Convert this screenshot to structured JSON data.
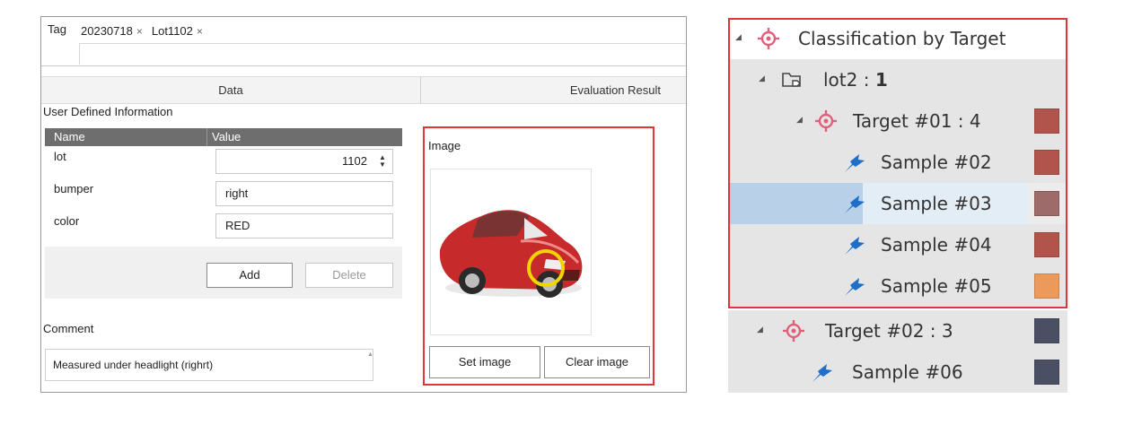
{
  "tag_panel": {
    "label": "Tag",
    "tags": [
      {
        "text": "20230718",
        "remove": "×"
      },
      {
        "text": "Lot1102",
        "remove": "×"
      }
    ]
  },
  "columns": {
    "data": "Data",
    "evaluation": "Evaluation Result"
  },
  "user_info": {
    "title": "User Defined Information",
    "headers": {
      "name": "Name",
      "value": "Value"
    },
    "rows": [
      {
        "name": "lot",
        "value": "1102"
      },
      {
        "name": "bumper",
        "value": "right"
      },
      {
        "name": "color",
        "value": "RED"
      }
    ],
    "add_label": "Add",
    "delete_label": "Delete"
  },
  "comment": {
    "label": "Comment",
    "text": "Measured under headlight (righrt)"
  },
  "image_section": {
    "label": "Image",
    "set_label": "Set image",
    "clear_label": "Clear image"
  },
  "tree": {
    "root": {
      "label": "Classification by Target",
      "icon": "target-icon"
    },
    "folder": {
      "label": "lot2 : ",
      "count": "1",
      "icon": "folder-tag-icon"
    },
    "target1": {
      "label": "Target #01 : 4",
      "color": "#b0544c"
    },
    "samples1": [
      {
        "label": "Sample #02",
        "color": "#b0544c"
      },
      {
        "label": "Sample #03",
        "color": "#9e6a6a"
      },
      {
        "label": "Sample #04",
        "color": "#b0544c"
      },
      {
        "label": "Sample #05",
        "color": "#ec9a5c"
      }
    ],
    "target2": {
      "label": "Target #02 : 3",
      "color": "#4b4f63"
    },
    "samples2": [
      {
        "label": "Sample #06",
        "color": "#4b4f63"
      }
    ],
    "colors": {
      "target_icon": "#e0607a",
      "sample_icon": "#1f6fc8",
      "highlight": "#e2343a"
    }
  }
}
